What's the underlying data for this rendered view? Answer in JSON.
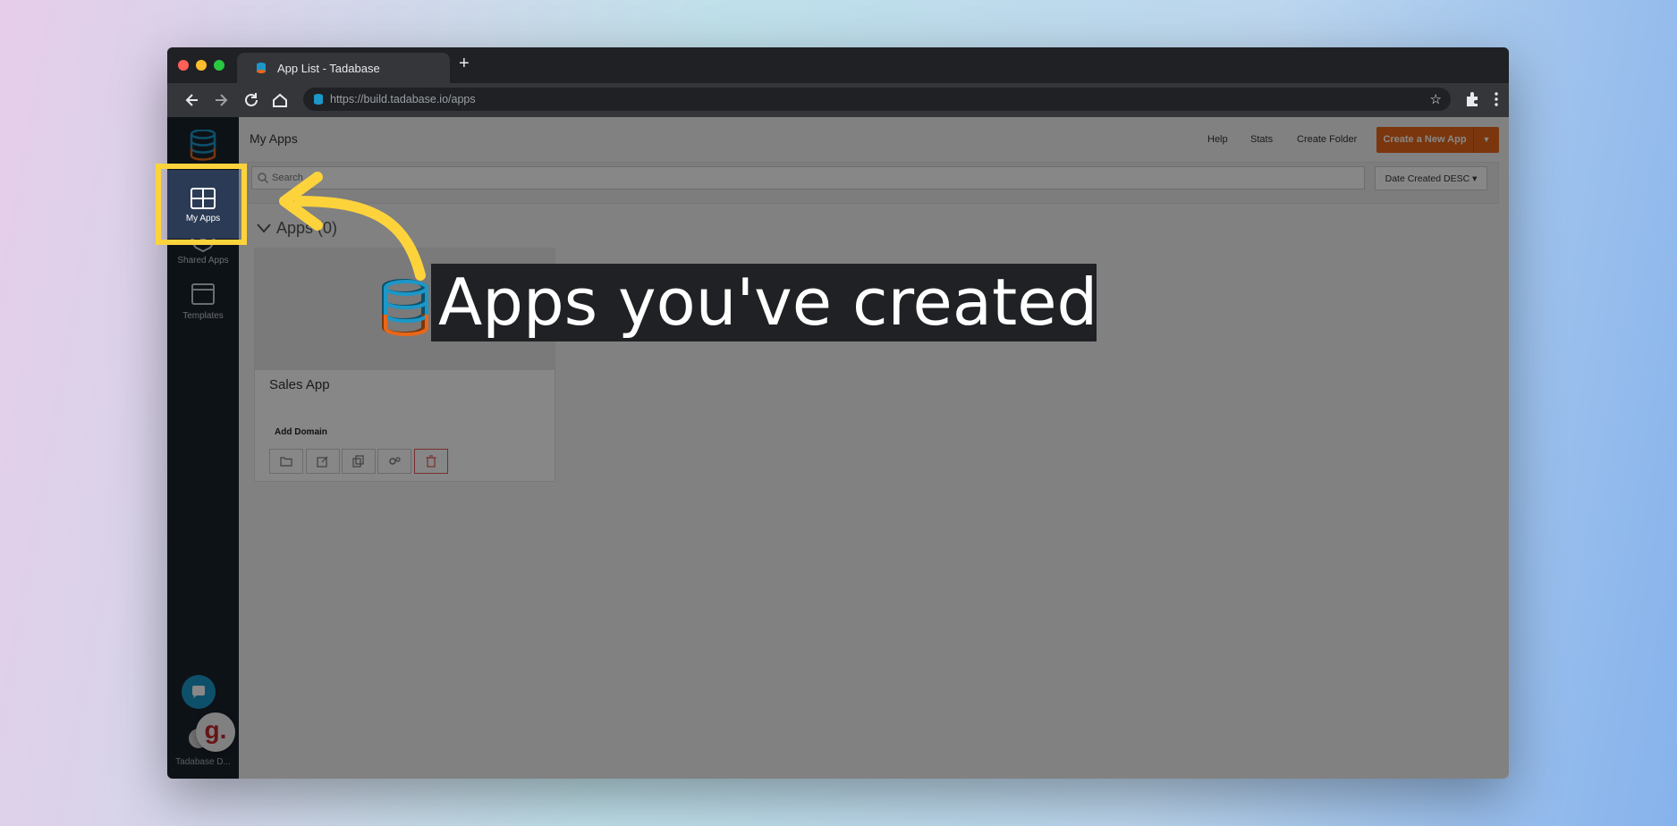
{
  "browser": {
    "tab_title": "App List - Tadabase",
    "new_tab_glyph": "+",
    "url": "https://build.tadabase.io/apps"
  },
  "sidebar": {
    "items": [
      {
        "label": "My Apps",
        "icon": "grid-icon",
        "active": true
      },
      {
        "label": "Shared Apps",
        "icon": "handshake-icon"
      },
      {
        "label": "Templates",
        "icon": "template-icon"
      }
    ],
    "footer_user": "Tadabase D..."
  },
  "header": {
    "title": "My Apps",
    "links": [
      "Help",
      "Stats",
      "Create Folder"
    ],
    "create_button": "Create a New App"
  },
  "search": {
    "placeholder": "Search",
    "sort_label": "Date Created DESC"
  },
  "section": {
    "title": "Apps (0)"
  },
  "apps": [
    {
      "name": "Sales App",
      "domain_label": "Add Domain"
    }
  ],
  "callout": {
    "text": "Apps you've created"
  },
  "colors": {
    "accent": "#e8671a",
    "highlight": "#fdd33c",
    "sidebar": "#1a222d"
  }
}
